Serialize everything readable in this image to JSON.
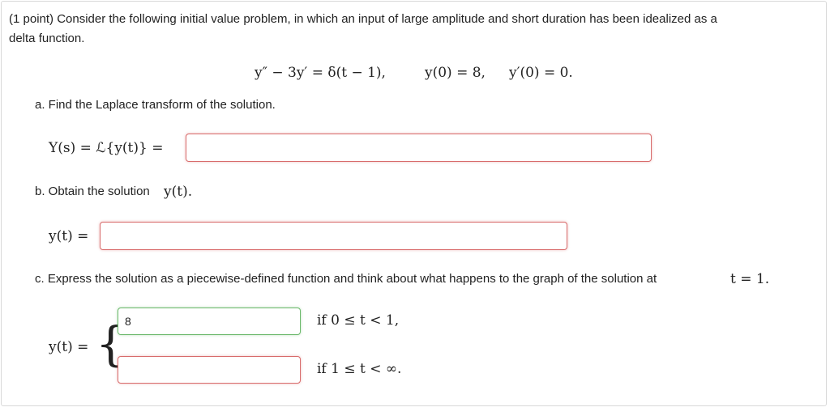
{
  "intro": {
    "line1": "(1 point) Consider the following initial value problem, in which an input of large amplitude and short duration has been idealized as a",
    "line2": "delta function."
  },
  "equation": {
    "ode": "y″ − 3y′ = δ(t − 1),",
    "ic1": "y(0) = 8,",
    "ic2": "y′(0) = 0."
  },
  "part_a": {
    "prompt": "a. Find the Laplace transform of the solution.",
    "label": "Y(s) = ℒ{y(t)} =",
    "value": ""
  },
  "part_b": {
    "prompt": "b. Obtain the solution",
    "prompt_math": "y(t).",
    "label": "y(t) =",
    "value": ""
  },
  "part_c": {
    "prompt": "c. Express the solution as a piecewise-defined function and think about what happens to the graph of the solution at",
    "prompt_math": "t = 1.",
    "label": "y(t) =",
    "brace": "{",
    "case1_value": "8",
    "case1_cond": "if 0 ≤ t < 1,",
    "case2_value": "",
    "case2_cond": "if 1 ≤ t < ∞."
  }
}
